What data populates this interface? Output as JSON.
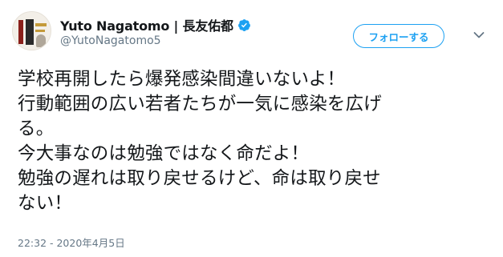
{
  "author": {
    "display_name": "Yuto Nagatomo | 長友佑都",
    "handle": "@YutoNagatomo5",
    "verified": true,
    "avatar_icon": "book-cover-avatar"
  },
  "follow_button": {
    "label": "フォローする"
  },
  "menu": {
    "icon": "chevron-down-icon"
  },
  "tweet": {
    "lines": [
      "学校再開したら爆発感染間違いないよ！",
      "行動範囲の広い若者たちが一気に感染を広げ",
      "る。",
      "今大事なのは勉強ではなく命だよ！",
      "勉強の遅れは取り戻せるけど、命は取り戻せ",
      "ない！"
    ]
  },
  "timestamp": "22:32 - 2020年4月5日",
  "colors": {
    "accent": "#1da1f2",
    "text": "#14171a",
    "secondary": "#657786"
  }
}
